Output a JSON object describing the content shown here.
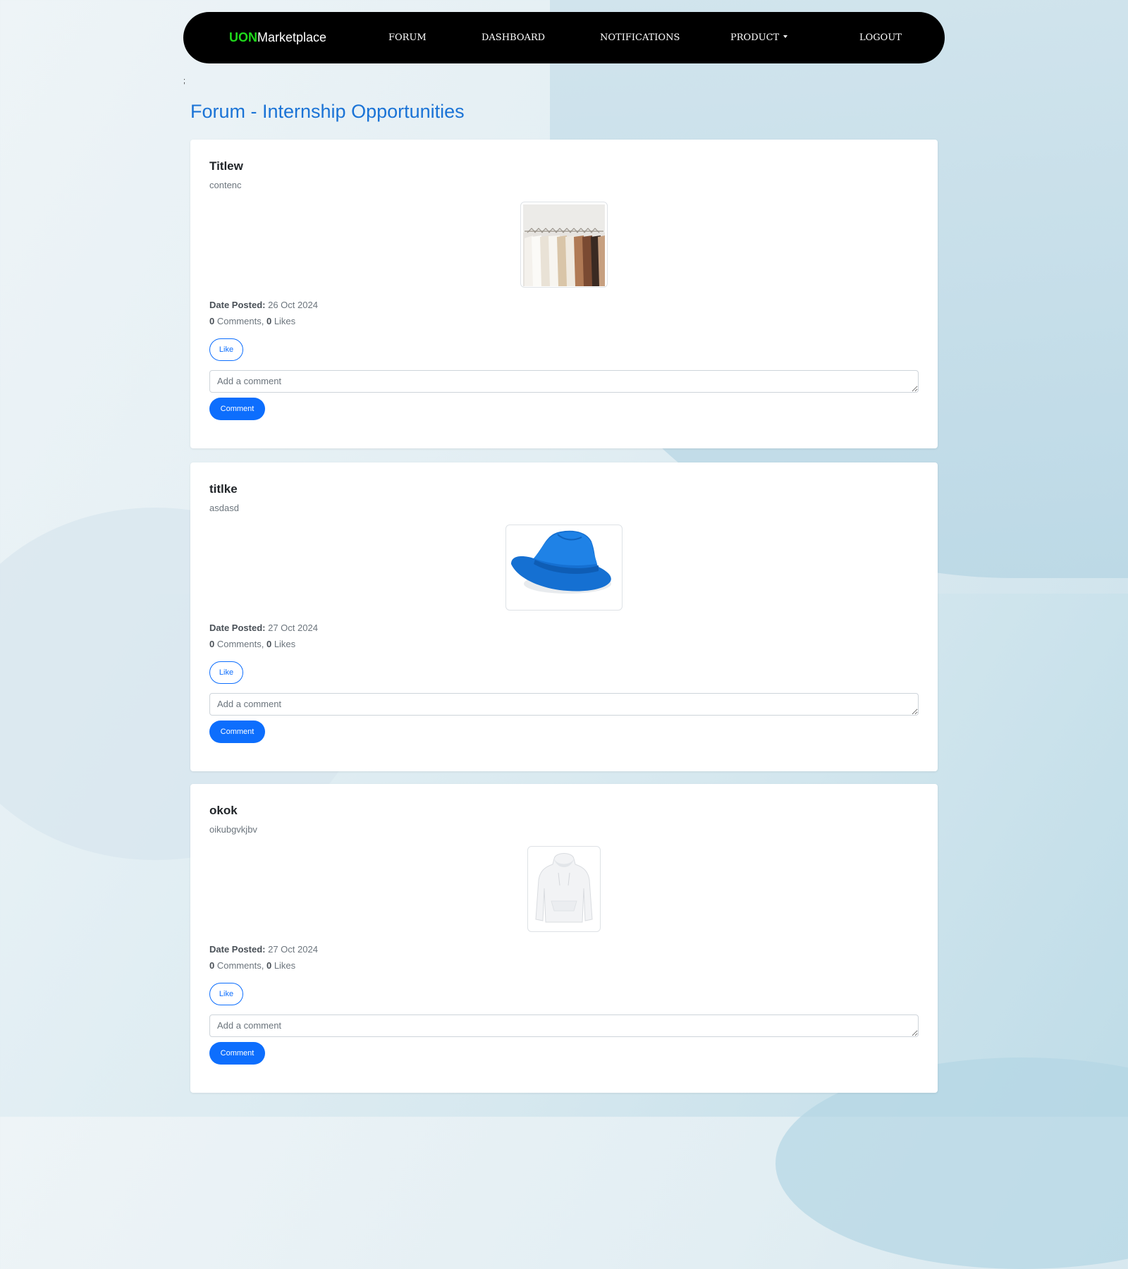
{
  "navbar": {
    "brand_accent": "UON",
    "brand_rest": "Marketplace",
    "links": {
      "forum": "FORUM",
      "dashboard": "DASHBOARD",
      "notifications": "NOTIFICATIONS",
      "product": "PRODUCT",
      "logout": "LOGOUT"
    }
  },
  "stray_text": ";",
  "page_title": "Forum - Internship Opportunities",
  "labels": {
    "date_posted": "Date Posted:",
    "comments": "Comments,",
    "likes": "Likes",
    "like_button": "Like",
    "comment_placeholder": "Add a comment",
    "comment_button": "Comment"
  },
  "posts": [
    {
      "title": "Titlew",
      "content": "contenc",
      "image": "clothes-rack-photo",
      "date": "26 Oct 2024",
      "comment_count": "0",
      "like_count": "0"
    },
    {
      "title": "titlke",
      "content": "asdasd",
      "image": "blue-hat-photo",
      "date": "27 Oct 2024",
      "comment_count": "0",
      "like_count": "0"
    },
    {
      "title": "okok",
      "content": "oikubgvkjbv",
      "image": "white-hoodie-photo",
      "date": "27 Oct 2024",
      "comment_count": "0",
      "like_count": "0"
    }
  ],
  "colors": {
    "brand_accent": "#1fd81b",
    "title_blue": "#1a73d6",
    "primary": "#0d6efd",
    "navbar_bg": "#000000"
  }
}
